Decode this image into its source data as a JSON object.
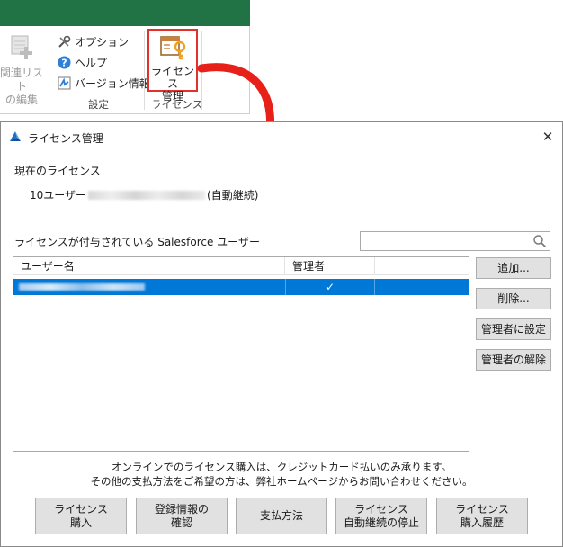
{
  "ribbon": {
    "related_list_edit": [
      "関連リスト",
      "の編集"
    ],
    "option": "オプション",
    "help": "ヘルプ",
    "version_info": "バージョン情報",
    "group_settings": "設定",
    "license_button": [
      "ライセンス",
      "管理"
    ],
    "group_license": "ライセンス",
    "band_color": "#217346",
    "highlight_color": "#e0312b"
  },
  "dialog": {
    "title": "ライセンス管理",
    "close": "✕",
    "current_license_label": "現在のライセンス",
    "current_license_prefix": "10ユーザー",
    "current_license_suffix": "(自動継続)",
    "users_label": "ライセンスが付与されている Salesforce ユーザー",
    "search_placeholder": "",
    "columns": {
      "user_name": "ユーザー名",
      "admin": "管理者"
    },
    "rows": [
      {
        "admin": "✓"
      }
    ],
    "buttons": {
      "add": "追加...",
      "delete": "削除...",
      "set_admin": "管理者に設定",
      "unset_admin": "管理者の解除"
    },
    "notice": [
      "オンラインでのライセンス購入は、クレジットカード払いのみ承ります。",
      "その他の支払方法をご希望の方は、弊社ホームページからお問い合わせください。"
    ],
    "bottom_buttons": {
      "purchase": [
        "ライセンス",
        "購入"
      ],
      "confirm": [
        "登録情報の",
        "確認"
      ],
      "payment": [
        "支払方法"
      ],
      "stop_auto_renew": [
        "ライセンス",
        "自動継続の停止"
      ],
      "history": [
        "ライセンス",
        "購入履歴"
      ]
    },
    "selection_color": "#0078d7"
  }
}
